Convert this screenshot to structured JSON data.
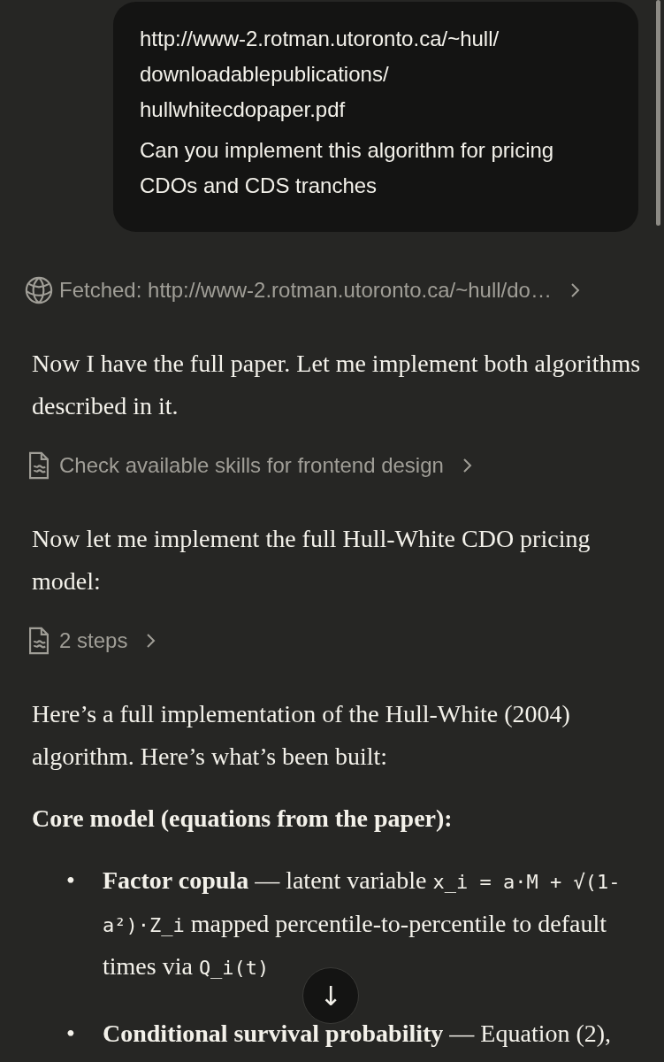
{
  "user_message": {
    "lines": [
      "http://www-2.rotman.utoronto.ca/~hull/",
      "downloadablepublications/",
      "hullwhitecdopaper.pdf"
    ],
    "text": "Can you implement this algorithm for pricing CDOs and CDS tranches"
  },
  "assistant": [
    {
      "kind": "fetch",
      "label": "Fetched: http://www-2.rotman.utoronto.ca/~hull/do…"
    },
    {
      "kind": "paragraph",
      "text": "Now I have the full paper. Let me implement both algorithms described in it."
    },
    {
      "kind": "step",
      "label": "Check available skills for frontend design"
    },
    {
      "kind": "paragraph",
      "text": "Now let me implement the full Hull-White CDO pricing model:"
    },
    {
      "kind": "step",
      "label": "2 steps"
    },
    {
      "kind": "paragraph",
      "text": "Here’s a full implementation of the Hull-White (2004) algorithm. Here’s what’s been built:"
    },
    {
      "kind": "heading",
      "text": "Core model (equations from the paper):"
    },
    {
      "kind": "bullets",
      "items": [
        {
          "marker": "•",
          "parts": [
            {
              "kind": "text",
              "text": "**Factor copula** — latent variable "
            },
            {
              "kind": "code",
              "text": "x_i = a·M + √(1-a²)·Z_i"
            },
            {
              "kind": "text",
              "text": " mapped percentile-to-percentile to default times via "
            },
            {
              "kind": "code",
              "text": "Q_i(t)"
            }
          ]
        },
        {
          "marker": "•",
          "parts": [
            {
              "kind": "text",
              "text": "**Conditional survival probability** — Equation (2),"
            }
          ]
        }
      ]
    }
  ],
  "scroll_button": {
    "label": "↓"
  }
}
